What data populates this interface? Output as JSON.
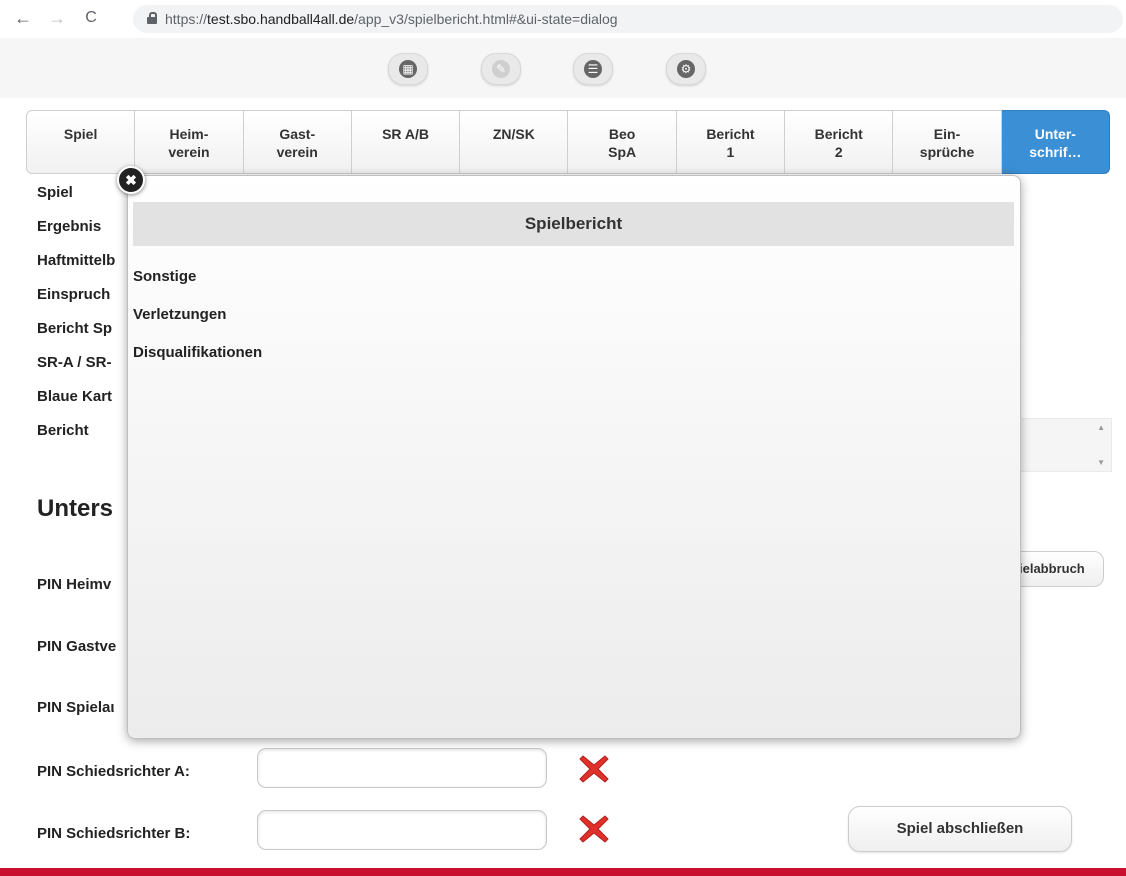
{
  "browser": {
    "back_icon": "←",
    "forward_icon": "→",
    "reload_icon": "C",
    "url_prefix": "https://",
    "url_host": "test.sbo.handball4all.de",
    "url_path": "/app_v3/spielbericht.html#&ui-state=dialog"
  },
  "toolbar": {
    "buttons": [
      {
        "icon": "grid-icon",
        "glyph": "▦"
      },
      {
        "icon": "edit-icon",
        "glyph": "✎"
      },
      {
        "icon": "menu-icon",
        "glyph": "☰"
      },
      {
        "icon": "gear-icon",
        "glyph": "⚙"
      }
    ]
  },
  "tabs": [
    {
      "line1": "Spiel",
      "line2": ""
    },
    {
      "line1": "Heim-",
      "line2": "verein"
    },
    {
      "line1": "Gast-",
      "line2": "verein"
    },
    {
      "line1": "SR A/B",
      "line2": ""
    },
    {
      "line1": "ZN/SK",
      "line2": ""
    },
    {
      "line1": "Beo",
      "line2": "SpA"
    },
    {
      "line1": "Bericht",
      "line2": "1"
    },
    {
      "line1": "Bericht",
      "line2": "2"
    },
    {
      "line1": "Ein-",
      "line2": "sprüche"
    },
    {
      "line1": "Unter-",
      "line2": "schrif…"
    }
  ],
  "page": {
    "left_labels": [
      "Spiel",
      "Ergebnis",
      "Haftmittelb",
      "Einspruch",
      "Bericht Sp",
      "SR-A / SR-",
      "Blaue Kart",
      "Bericht"
    ],
    "section_heading": "Unters",
    "pin_labels": [
      "PIN Heimv",
      "PIN Gastve",
      "PIN Spielaι",
      "PIN Schiedsrichter A:",
      "PIN Schiedsrichter B:"
    ],
    "abbruch_label": "ielabbruch",
    "abschliessen_label": "Spiel abschließen",
    "status_icon": "red-x-icon",
    "footer_color": "#c8102e"
  },
  "dialog": {
    "title": "Spielbericht",
    "items": [
      "Sonstige",
      "Verletzungen",
      "Disqualifikationen"
    ],
    "close_glyph": "✖"
  },
  "colors": {
    "active_tab": "#3b8fd4",
    "red_x": "#e0302a"
  }
}
